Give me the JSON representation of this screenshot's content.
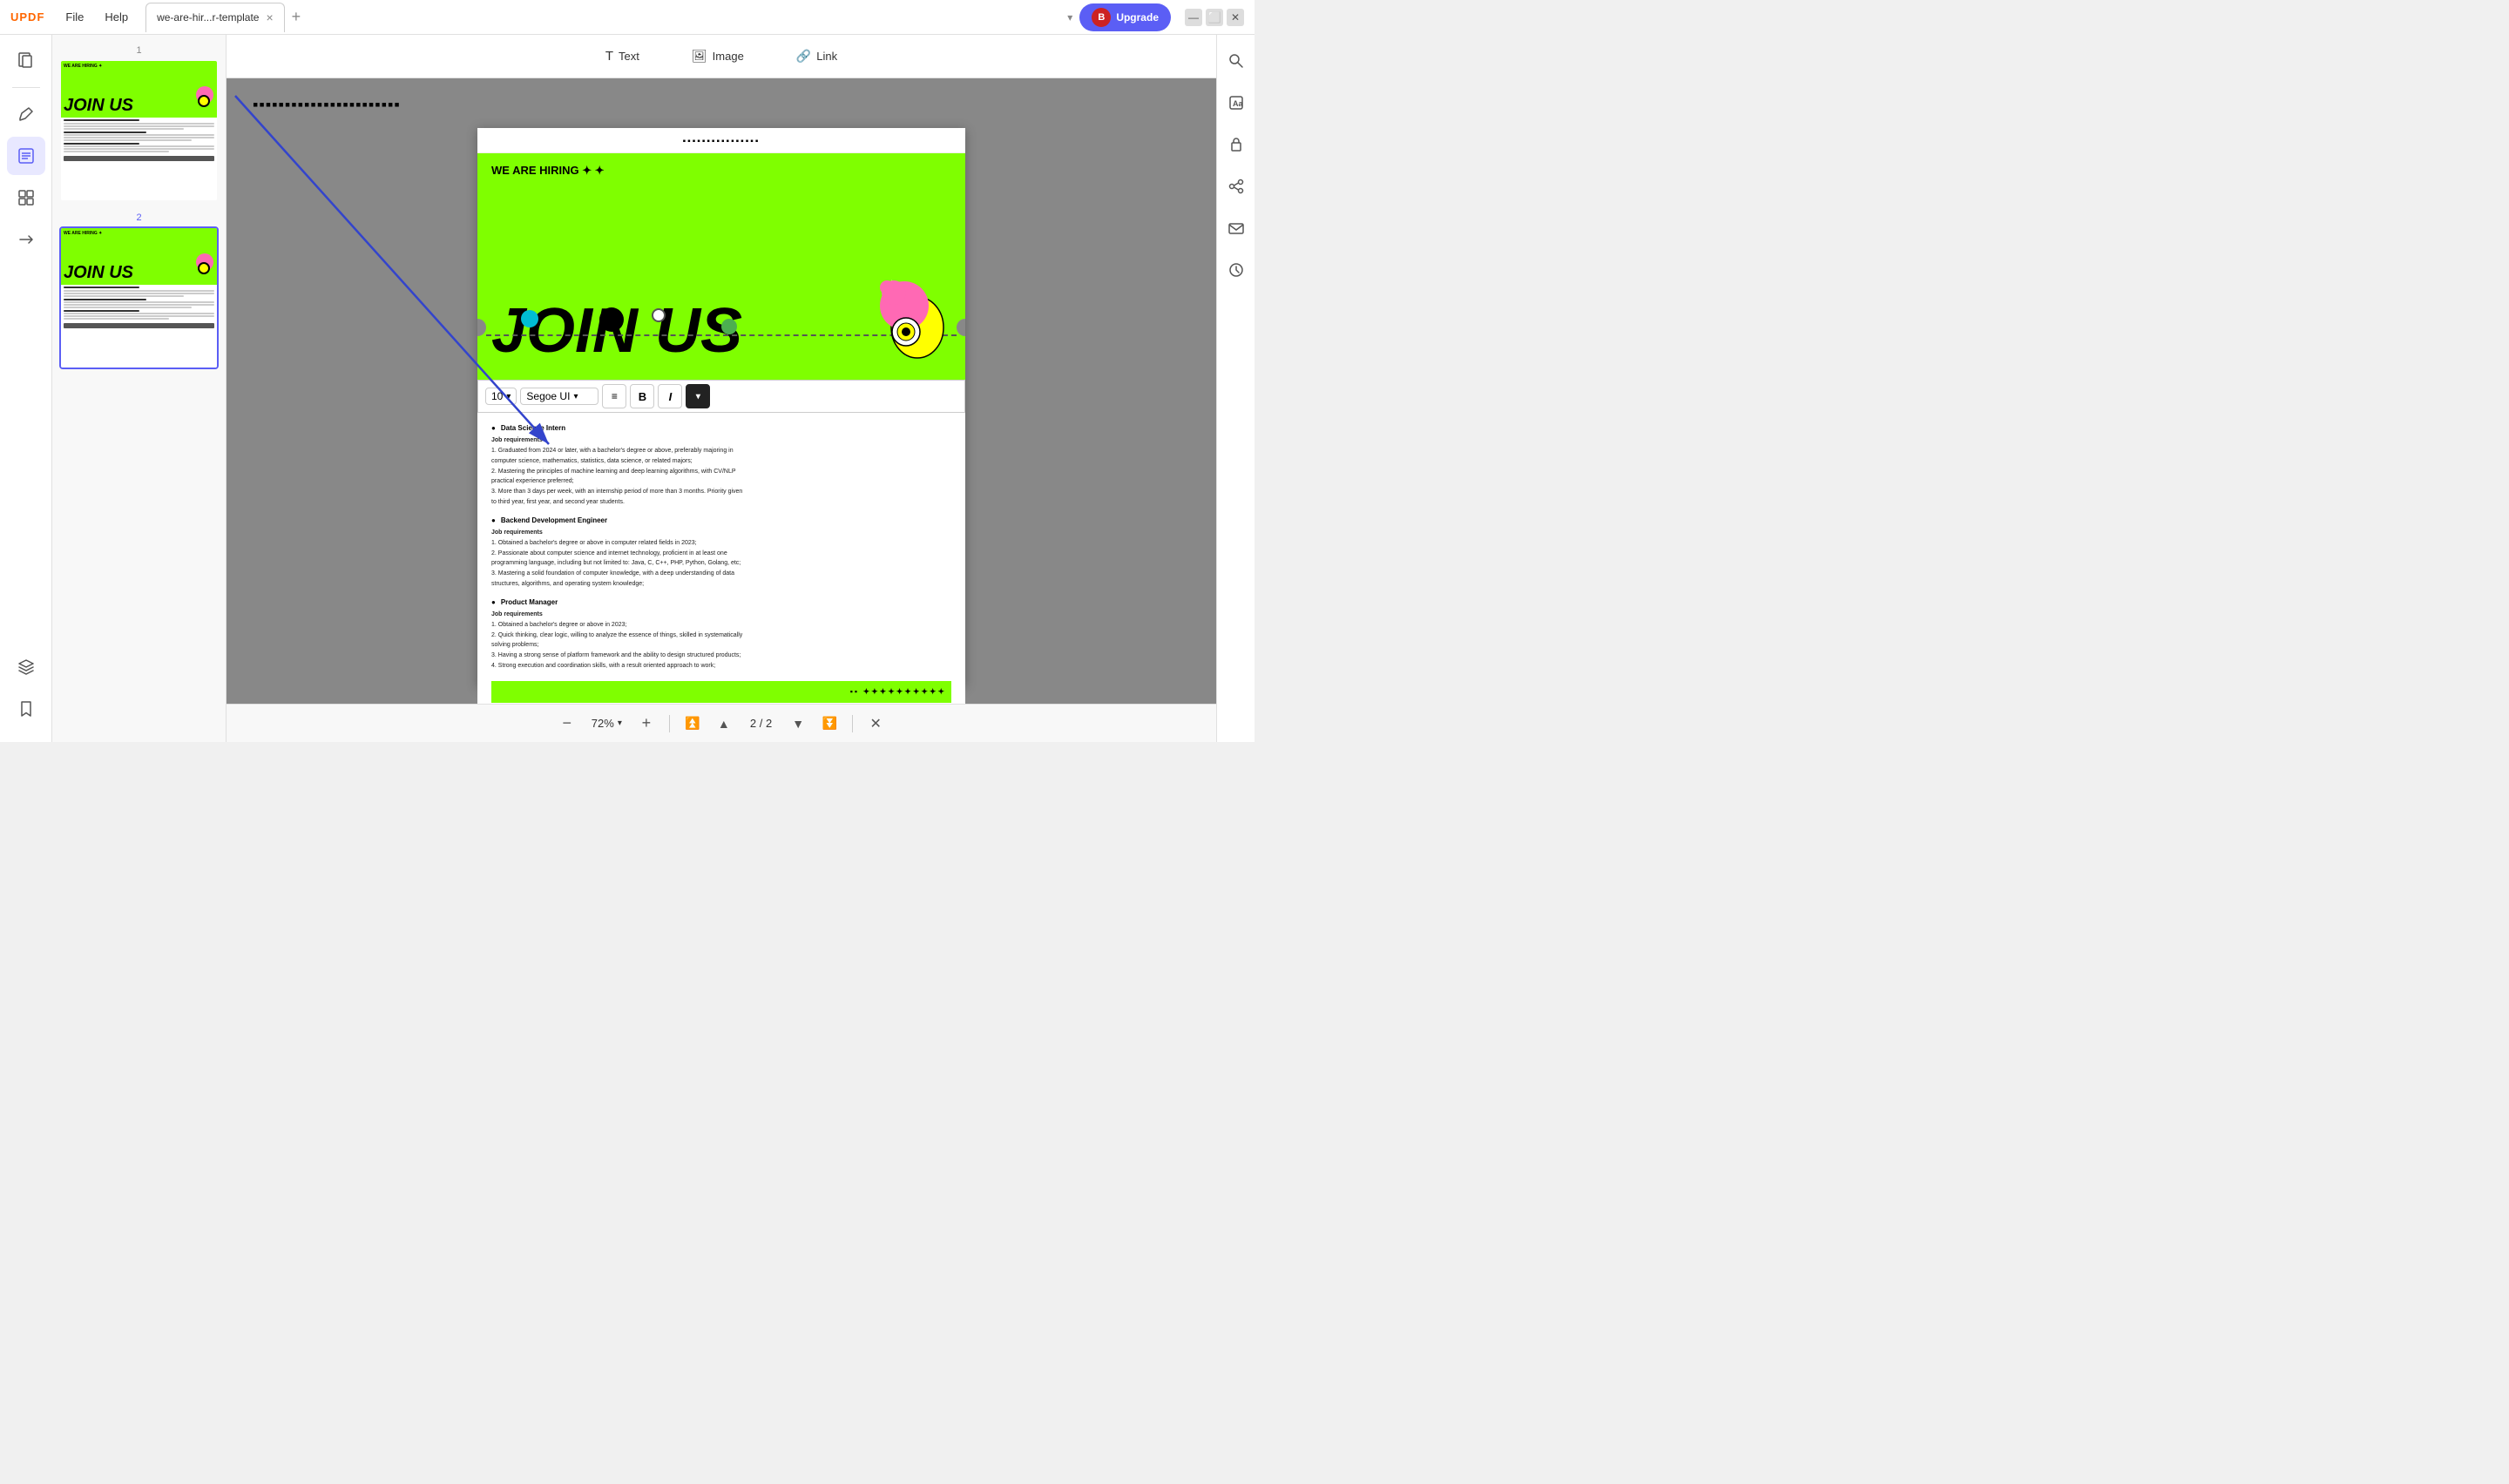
{
  "app": {
    "logo": "UPDF",
    "menu": [
      "File",
      "Help"
    ],
    "tab_name": "we-are-hir...r-template",
    "upgrade_label": "Upgrade",
    "upgrade_avatar": "B"
  },
  "toolbar": {
    "text_label": "Text",
    "image_label": "Image",
    "link_label": "Link"
  },
  "left_sidebar": {
    "icons": [
      "pages",
      "annotate",
      "edit",
      "organize",
      "convert",
      "sign",
      "layers",
      "bookmark"
    ]
  },
  "right_sidebar": {
    "icons": [
      "search",
      "ocr",
      "security",
      "share",
      "email",
      "history"
    ]
  },
  "thumbnail_panel": {
    "pages": [
      {
        "num": "1",
        "selected": false
      },
      {
        "num": "2",
        "selected": true
      }
    ]
  },
  "text_editing_toolbar": {
    "font_size": "10",
    "font_family": "Segoe UI",
    "bold": "B",
    "italic": "I",
    "color_active": "#222222"
  },
  "page_content": {
    "checker_top": "▪▪▪▪▪▪▪▪▪▪▪▪",
    "hiring_label": "WE ARE HIRING ✦ ✦",
    "join_us": "JOIN US",
    "section1_title": "Data Science Intern",
    "section1_sub": "Job requirements",
    "section1_lines": [
      "1. Graduated from 2024 or later, with a bachelor's degree or above, preferably majoring in",
      "computer science, mathematics, statistics, data science, or related majors;",
      "2. Mastering the principles of machine learning and deep learning algorithms, with CV/NLP",
      "practical experience preferred;",
      "3. More than 3 days per week, with an internship period of more than 3 months. Priority given",
      "to third year, first year, and second year students."
    ],
    "section2_title": "Backend Development Engineer",
    "section2_sub": "Job requirements",
    "section2_lines": [
      "1. Obtained a bachelor's degree or above in computer related fields in 2023;",
      "2. Passionate about computer science and internet technology, proficient in at least one",
      "programming language, including but not limited to: Java, C, C++, PHP, Python, Golang, etc;",
      "3. Mastering a solid foundation of computer knowledge, with a deep understanding of data",
      "structures, algorithms, and operating system knowledge;"
    ],
    "section3_title": "Product Manager",
    "section3_sub": "Job requirements",
    "section3_lines": [
      "1. Obtained a bachelor's degree or above in 2023;",
      "2. Quick thinking, clear logic, willing to analyze the essence of things, skilled in systematically",
      "solving problems;",
      "3. Having a strong sense of platform framework and the ability to design structured products;",
      "4. Strong execution and coordination skills, with a result oriented approach to work;"
    ],
    "checker_bottom": "▪▪ ✦✦✦✦✦✦✦✦✦✦"
  },
  "zoom": {
    "value": "72%",
    "current_page": "2",
    "total_pages": "2"
  },
  "colors": {
    "accent": "#5b5ef5",
    "green_bg": "#7fff00",
    "tab_active_bg": "#ffffff"
  }
}
